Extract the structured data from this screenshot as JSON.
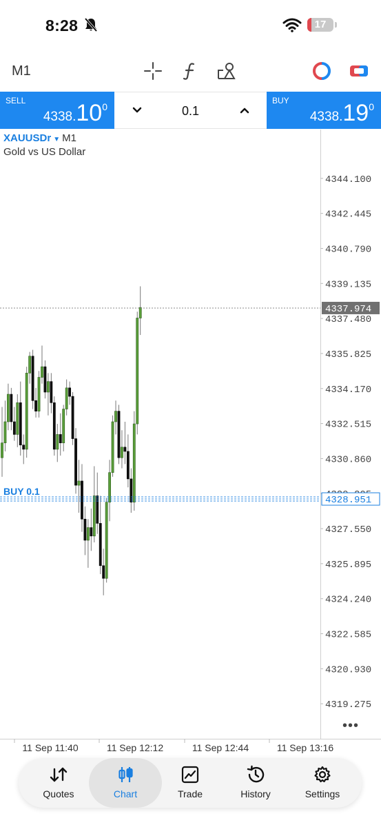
{
  "status_bar": {
    "time": "8:28",
    "battery": "17",
    "battery_level": 0.17
  },
  "toolbar": {
    "timeframe": "M1",
    "icons": [
      "crosshair-icon",
      "function-icon",
      "objects-icon",
      "one-click-trading-icon",
      "trade-panel-icon"
    ]
  },
  "trade_panel": {
    "sell": {
      "label": "SELL",
      "price_small": "4338.",
      "price_big": "10",
      "price_sup": "0"
    },
    "buy": {
      "label": "BUY",
      "price_small": "4338.",
      "price_big": "19",
      "price_sup": "0"
    },
    "volume": "0.1"
  },
  "chart": {
    "symbol": "XAUUSDr",
    "timeframe": "M1",
    "description": "Gold vs US Dollar",
    "order_label": "BUY 0.1",
    "colors": {
      "bull": "#5a9e3a",
      "bear": "#111111",
      "accent": "#1a7fe0",
      "price_tag": "#707070"
    }
  },
  "chart_data": {
    "type": "candlestick",
    "y_ticks": [
      "4344.100",
      "4342.445",
      "4340.790",
      "4339.135",
      "4337.480",
      "4335.825",
      "4334.170",
      "4332.515",
      "4330.860",
      "4329.205",
      "4327.550",
      "4325.895",
      "4324.240",
      "4322.585",
      "4320.930",
      "4319.275"
    ],
    "ylim": [
      4317.62,
      4345.755
    ],
    "x_ticks": [
      "11 Sep 11:40",
      "11 Sep 12:12",
      "11 Sep 12:44",
      "11 Sep 13:16"
    ],
    "current_price": "4337.974",
    "current_price_value": 4337.974,
    "order_price": "4328.951",
    "order_price_value": 4328.951,
    "candles": [
      {
        "o": 4330.9,
        "h": 4333.3,
        "l": 4330.0,
        "c": 4331.6
      },
      {
        "o": 4331.6,
        "h": 4333.6,
        "l": 4331.2,
        "c": 4332.6
      },
      {
        "o": 4332.6,
        "h": 4334.4,
        "l": 4332.2,
        "c": 4333.9
      },
      {
        "o": 4333.9,
        "h": 4334.2,
        "l": 4332.2,
        "c": 4332.6
      },
      {
        "o": 4332.6,
        "h": 4333.3,
        "l": 4331.7,
        "c": 4332.0
      },
      {
        "o": 4332.0,
        "h": 4333.9,
        "l": 4331.4,
        "c": 4333.5
      },
      {
        "o": 4333.5,
        "h": 4334.5,
        "l": 4331.0,
        "c": 4331.5
      },
      {
        "o": 4331.5,
        "h": 4332.0,
        "l": 4330.6,
        "c": 4331.3
      },
      {
        "o": 4331.3,
        "h": 4335.2,
        "l": 4330.9,
        "c": 4334.9
      },
      {
        "o": 4334.9,
        "h": 4335.9,
        "l": 4334.4,
        "c": 4335.7
      },
      {
        "o": 4335.7,
        "h": 4336.0,
        "l": 4333.2,
        "c": 4333.6
      },
      {
        "o": 4333.6,
        "h": 4334.2,
        "l": 4332.8,
        "c": 4333.1
      },
      {
        "o": 4333.1,
        "h": 4335.0,
        "l": 4332.8,
        "c": 4334.7
      },
      {
        "o": 4334.7,
        "h": 4336.2,
        "l": 4334.4,
        "c": 4335.2
      },
      {
        "o": 4335.2,
        "h": 4335.5,
        "l": 4333.7,
        "c": 4334.0
      },
      {
        "o": 4334.0,
        "h": 4334.9,
        "l": 4332.9,
        "c": 4334.5
      },
      {
        "o": 4334.5,
        "h": 4334.9,
        "l": 4333.0,
        "c": 4333.5
      },
      {
        "o": 4333.5,
        "h": 4333.8,
        "l": 4331.0,
        "c": 4331.3
      },
      {
        "o": 4331.3,
        "h": 4332.5,
        "l": 4330.7,
        "c": 4332.0
      },
      {
        "o": 4332.0,
        "h": 4333.0,
        "l": 4331.0,
        "c": 4331.6
      },
      {
        "o": 4331.6,
        "h": 4333.4,
        "l": 4331.2,
        "c": 4333.2
      },
      {
        "o": 4333.2,
        "h": 4334.6,
        "l": 4332.9,
        "c": 4334.2
      },
      {
        "o": 4334.2,
        "h": 4334.5,
        "l": 4333.4,
        "c": 4333.8
      },
      {
        "o": 4333.8,
        "h": 4334.0,
        "l": 4331.5,
        "c": 4331.8
      },
      {
        "o": 4331.8,
        "h": 4332.3,
        "l": 4329.2,
        "c": 4329.6
      },
      {
        "o": 4329.6,
        "h": 4330.8,
        "l": 4328.3,
        "c": 4329.8
      },
      {
        "o": 4329.8,
        "h": 4330.6,
        "l": 4327.4,
        "c": 4328.0
      },
      {
        "o": 4328.0,
        "h": 4328.6,
        "l": 4326.3,
        "c": 4327.0
      },
      {
        "o": 4327.0,
        "h": 4328.0,
        "l": 4325.7,
        "c": 4327.6
      },
      {
        "o": 4327.6,
        "h": 4328.5,
        "l": 4326.5,
        "c": 4327.2
      },
      {
        "o": 4327.2,
        "h": 4330.5,
        "l": 4326.9,
        "c": 4329.1
      },
      {
        "o": 4329.1,
        "h": 4330.2,
        "l": 4327.3,
        "c": 4327.8
      },
      {
        "o": 4327.8,
        "h": 4329.1,
        "l": 4325.4,
        "c": 4325.8
      },
      {
        "o": 4325.8,
        "h": 4326.6,
        "l": 4324.4,
        "c": 4325.2
      },
      {
        "o": 4325.2,
        "h": 4329.0,
        "l": 4325.0,
        "c": 4328.8
      },
      {
        "o": 4328.8,
        "h": 4330.8,
        "l": 4327.9,
        "c": 4330.2
      },
      {
        "o": 4330.2,
        "h": 4332.9,
        "l": 4330.0,
        "c": 4332.6
      },
      {
        "o": 4332.6,
        "h": 4333.6,
        "l": 4332.0,
        "c": 4333.1
      },
      {
        "o": 4333.1,
        "h": 4333.4,
        "l": 4330.6,
        "c": 4330.9
      },
      {
        "o": 4330.9,
        "h": 4332.2,
        "l": 4330.4,
        "c": 4331.4
      },
      {
        "o": 4331.4,
        "h": 4332.6,
        "l": 4330.6,
        "c": 4331.2
      },
      {
        "o": 4331.2,
        "h": 4332.0,
        "l": 4329.5,
        "c": 4329.9
      },
      {
        "o": 4329.9,
        "h": 4330.4,
        "l": 4328.3,
        "c": 4328.8
      },
      {
        "o": 4328.8,
        "h": 4333.1,
        "l": 4328.4,
        "c": 4332.5
      },
      {
        "o": 4332.5,
        "h": 4337.8,
        "l": 4332.0,
        "c": 4337.5
      },
      {
        "o": 4337.5,
        "h": 4339.0,
        "l": 4336.7,
        "c": 4338.0
      }
    ]
  },
  "nav": {
    "items": [
      {
        "label": "Quotes",
        "icon": "quotes-icon"
      },
      {
        "label": "Chart",
        "icon": "chart-icon",
        "active": true
      },
      {
        "label": "Trade",
        "icon": "trade-icon"
      },
      {
        "label": "History",
        "icon": "history-icon"
      },
      {
        "label": "Settings",
        "icon": "settings-icon"
      }
    ]
  }
}
